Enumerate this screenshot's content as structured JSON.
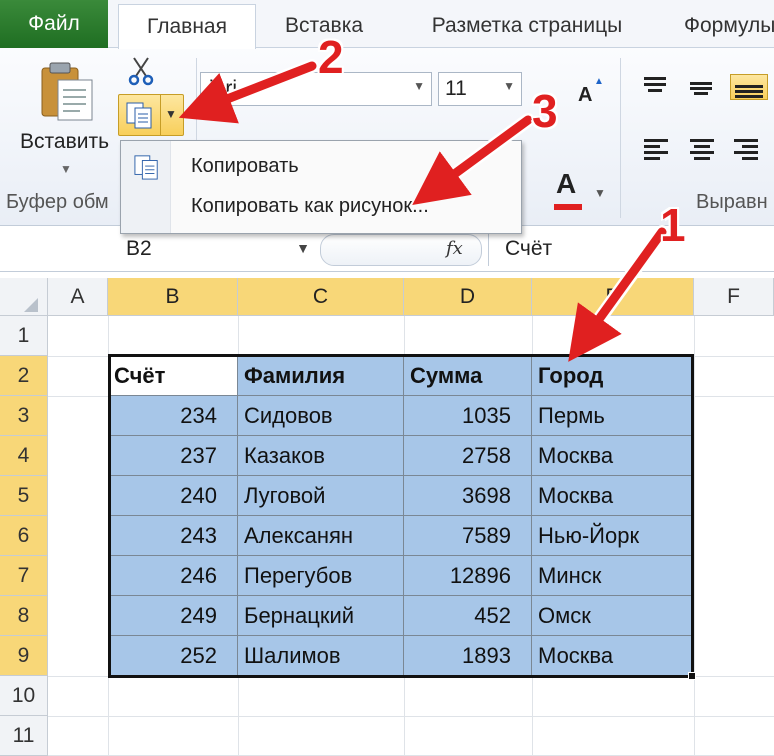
{
  "tabs": {
    "file": "Файл",
    "items": [
      "Главная",
      "Вставка",
      "Разметка страницы",
      "Формулы"
    ],
    "active": "Главная"
  },
  "ribbon": {
    "paste_label": "Вставить",
    "clipboard_group": "Буфер обм",
    "font_name": "ibri",
    "font_size": "11",
    "align_group": "Выравн",
    "font_color_letter": "A",
    "grow_letter": "A"
  },
  "menu": {
    "copy": "Копировать",
    "copy_as_picture": "Копировать как рисунок..."
  },
  "formula_bar": {
    "name_box": "B2",
    "fx": "fx",
    "value": "Счёт"
  },
  "sheet": {
    "columns": [
      "A",
      "B",
      "C",
      "D",
      "E",
      "F"
    ],
    "rows": [
      "1",
      "2",
      "3",
      "4",
      "5",
      "6",
      "7",
      "8",
      "9",
      "10",
      "11"
    ],
    "headers": [
      "Счёт",
      "Фамилия",
      "Сумма",
      "Город"
    ],
    "data": [
      [
        "234",
        "Сидовов",
        "1035",
        "Пермь"
      ],
      [
        "237",
        "Казаков",
        "2758",
        "Москва"
      ],
      [
        "240",
        "Луговой",
        "3698",
        "Москва"
      ],
      [
        "243",
        "Алексанян",
        "7589",
        "Нью-Йорк"
      ],
      [
        "246",
        "Перегубов",
        "12896",
        "Минск"
      ],
      [
        "249",
        "Бернацкий",
        "452",
        "Омск"
      ],
      [
        "252",
        "Шалимов",
        "1893",
        "Москва"
      ]
    ]
  },
  "annotations": [
    "1",
    "2",
    "3"
  ],
  "colors": {
    "file_tab": "#2a7d2e",
    "highlight": "#f8d778",
    "selection_fill": "#a7c6e8",
    "annotation": "#e02020"
  },
  "icons": [
    "paste-icon",
    "cut-icon",
    "copy-icon",
    "chevron-down-icon",
    "font-color-icon",
    "grow-font-icon",
    "align-icon",
    "fx-icon"
  ]
}
